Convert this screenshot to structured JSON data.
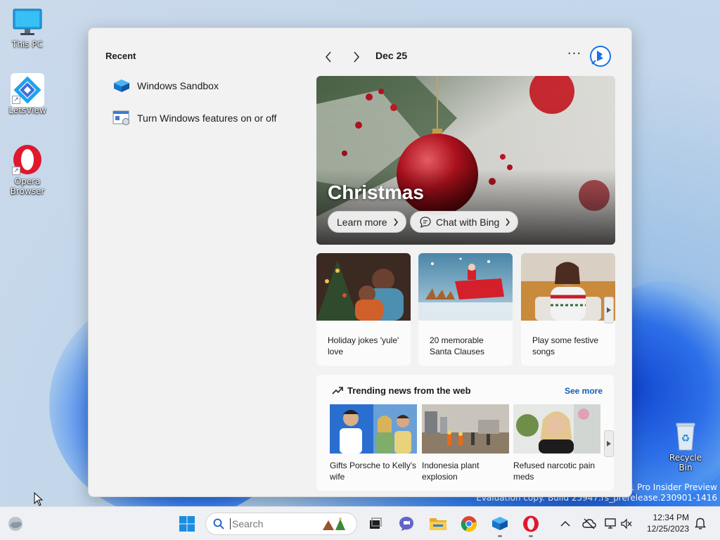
{
  "desktop": {
    "icons": [
      {
        "label": "This PC"
      },
      {
        "label": "LetsView"
      },
      {
        "label": "Opera Browser"
      },
      {
        "label": "Recycle Bin"
      }
    ],
    "watermark": {
      "line1": "11 Pro Insider Preview",
      "line2": "Evaluation copy. Build 25947.rs_prerelease.230901-1416"
    }
  },
  "widgets": {
    "recent": {
      "title": "Recent",
      "items": [
        {
          "label": "Windows Sandbox",
          "icon": "sandbox-icon"
        },
        {
          "label": "Turn Windows features on or off",
          "icon": "windows-features-icon"
        }
      ]
    },
    "header": {
      "date": "Dec 25",
      "more": "···"
    },
    "hero": {
      "title": "Christmas",
      "learn_more": "Learn more",
      "chat_bing": "Chat with Bing"
    },
    "cards": [
      {
        "title": "Holiday jokes 'yule' love"
      },
      {
        "title": "20 memorable Santa Clauses"
      },
      {
        "title": "Play some festive songs"
      }
    ],
    "trending": {
      "title": "Trending news from the web",
      "see_more": "See more",
      "items": [
        {
          "title": "Gifts Porsche to Kelly's wife"
        },
        {
          "title": "Indonesia plant explosion"
        },
        {
          "title": "Refused narcotic pain meds"
        }
      ]
    }
  },
  "taskbar": {
    "search_placeholder": "Search",
    "time": "12:34 PM",
    "date": "12/25/2023"
  },
  "colors": {
    "accent": "#0f5fb8",
    "panel_bg": "#f2f2f2",
    "taskbar_bg": "#eef0f3"
  }
}
